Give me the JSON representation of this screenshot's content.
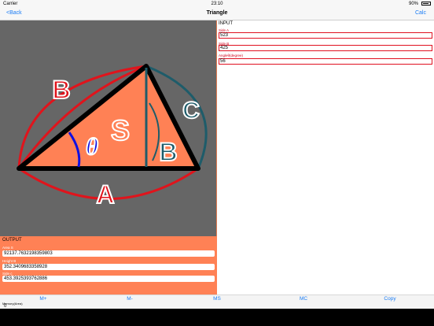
{
  "status_bar": {
    "carrier": "Carrier",
    "time": "23:10",
    "battery": "90%",
    "battery_level": 0.9
  },
  "nav": {
    "back_label": "<Back",
    "title": "Triangle",
    "calc_label": "Calc"
  },
  "diagram": {
    "label_b_side": "B",
    "label_c": "C",
    "label_s": "S",
    "label_theta": "θ",
    "label_b_height": "B",
    "label_a": "A",
    "colors": {
      "triangle_fill": "#ff8155",
      "arc_a_b": "#e0141c",
      "arc_c": "#1e5c6a",
      "angle_arc": "#1010e0",
      "background": "#666666"
    }
  },
  "output": {
    "heading": "OUTPUT",
    "area_label": "Area S",
    "area_value": "92137.7632198359803",
    "height_label": "Height B",
    "height_value": "352.3409683358928",
    "side_c_label": "Side c",
    "side_c_value": "453.3925393762886"
  },
  "input": {
    "heading": "INPUT",
    "side_a_label": "Side A",
    "side_a_value": "523",
    "side_b_label": "Side B",
    "side_b_value": "425",
    "angle_label": "Angleθ(degree)",
    "angle_value": "56"
  },
  "toolbar": {
    "m_plus": "M+",
    "m_minus": "M-",
    "ms": "MS",
    "mc": "MC",
    "copy": "Copy"
  },
  "memory": {
    "label": "Memory(Area)",
    "value": "0"
  }
}
